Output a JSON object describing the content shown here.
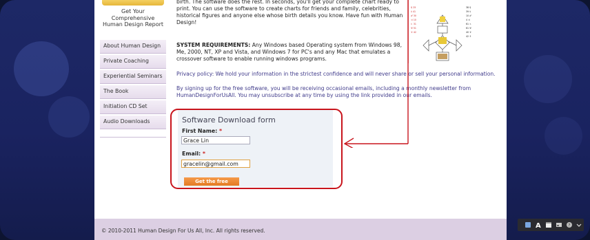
{
  "sidebar": {
    "report_box": "Get Your Comprehensive Human Design Report",
    "items": [
      "About Human Design",
      "Private Coaching",
      "Experiential Seminars",
      "The Book",
      "Initiation CD Set",
      "Audio Downloads"
    ]
  },
  "content": {
    "para1": "birth. The software does the rest. In seconds, you'll get your complete chart ready to print. You can use the software to create charts for friends and family, celebrities, historical figures and anyone else whose birth details you know. Have fun with Human Design!",
    "sysreq_label": "SYSTEM REQUIREMENTS:",
    "sysreq_text": " Any Windows based Operating system from Windows 98, Me, 2000, NT, XP and Vista, and Windows 7 for PC's and any Mac that emulates a crossover software to enable running windows programs.",
    "privacy": "Privacy policy: We hold your information in the strictest confidence and will never share or sell your personal information.",
    "signup_note": "By signing up for the free software, you will be receiving occasional emails, including a monthly newsletter from HumanDesignForUsAll. You may unsubscribe at any time by using the link provided in our emails."
  },
  "form": {
    "title": "Software Download form",
    "first_name_label": "First Name:",
    "first_name_value": "Grace Lin",
    "email_label": "Email:",
    "email_value": "gracelin@gmail.com",
    "required_mark": "*",
    "submit_label": "Get the free software"
  },
  "footer": {
    "copyright": "© 2010-2011 Human Design For Us All, Inc. All rights reserved."
  },
  "annotation": {
    "color": "#c8141c"
  }
}
